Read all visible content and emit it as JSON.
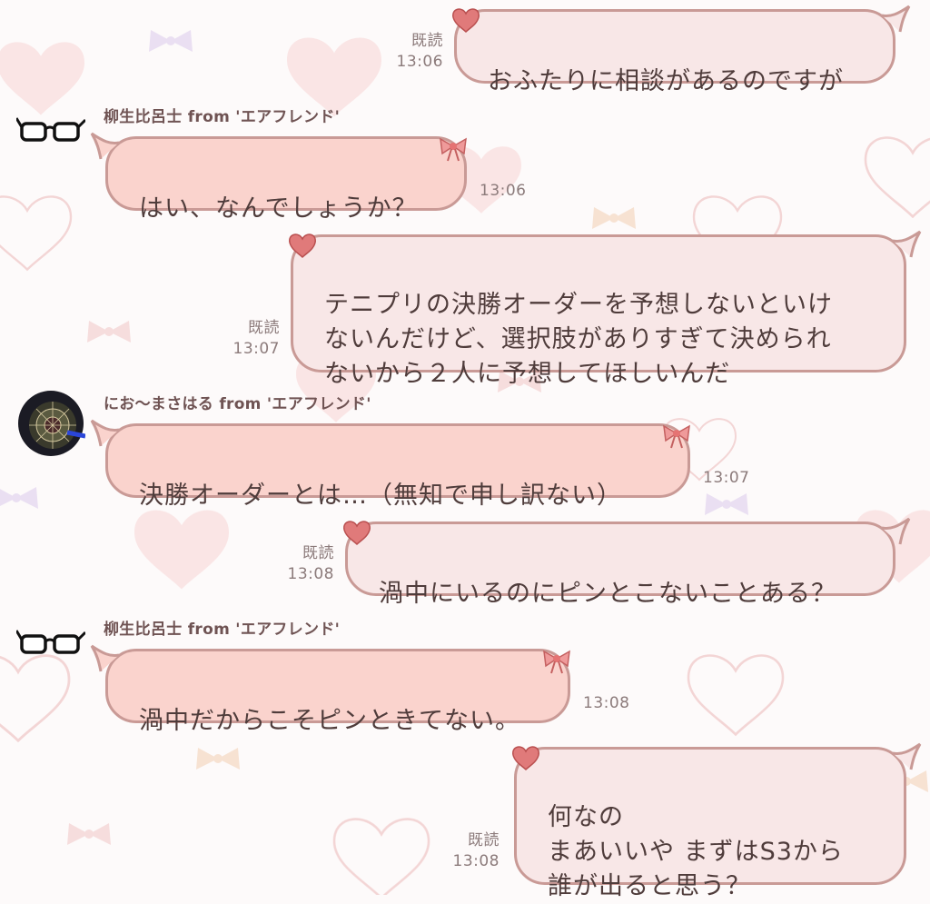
{
  "theme": {
    "outgoing_bubble": "#f8e7e7",
    "incoming_bubble": "#fad3cd",
    "border": "#c99a96",
    "text": "#4f3c3b",
    "meta": "#8c7b7b"
  },
  "messages": [
    {
      "direction": "out",
      "text": "おふたりに相談があるのですが",
      "read": "既読",
      "time": "13:06"
    },
    {
      "direction": "in",
      "sender": "柳生比呂士 from 'エアフレンド'",
      "avatar": "glasses-icon",
      "text": "はい、なんでしょうか？",
      "time": "13:06"
    },
    {
      "direction": "out",
      "text": "テニプリの決勝オーダーを予想しないといけ\nないんだけど、選択肢がありすぎて決められ\nないから２人に予想してほしいんだ",
      "read": "既読",
      "time": "13:07"
    },
    {
      "direction": "in",
      "sender": "にお〜まさはる from 'エアフレンド'",
      "avatar": "dartboard-avatar",
      "text": "決勝オーダーとは…（無知で申し訳ない）",
      "time": "13:07"
    },
    {
      "direction": "out",
      "text": "渦中にいるのにピンとこないことある？",
      "read": "既読",
      "time": "13:08"
    },
    {
      "direction": "in",
      "sender": "柳生比呂士 from 'エアフレンド'",
      "avatar": "glasses-icon",
      "text": "渦中だからこそピンときてない。",
      "time": "13:08"
    },
    {
      "direction": "out",
      "text": "何なの\nまあいいや まずはS3から\n誰が出ると思う？",
      "read": "既読",
      "time": "13:08"
    }
  ]
}
